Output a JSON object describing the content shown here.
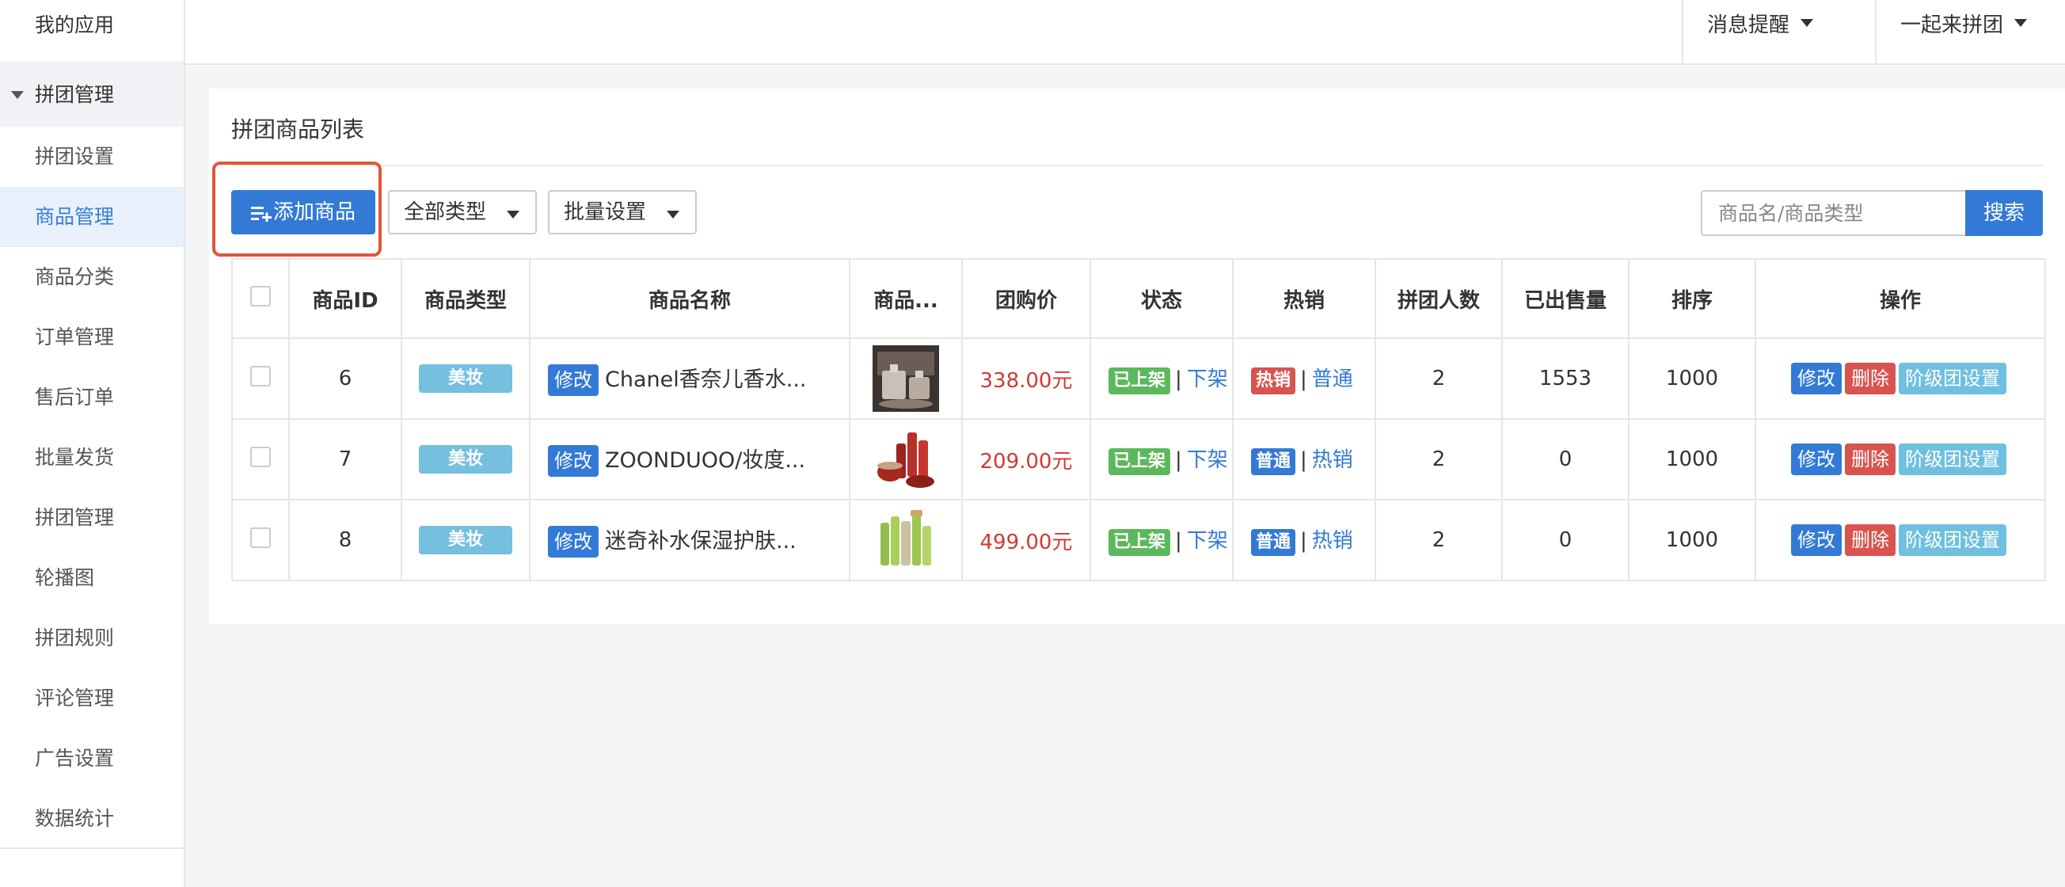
{
  "sidebar": {
    "app_title": "我的应用",
    "group_label": "拼团管理",
    "items": [
      {
        "label": "拼团设置",
        "active": false
      },
      {
        "label": "商品管理",
        "active": true
      },
      {
        "label": "商品分类",
        "active": false
      },
      {
        "label": "订单管理",
        "active": false
      },
      {
        "label": "售后订单",
        "active": false
      },
      {
        "label": "批量发货",
        "active": false
      },
      {
        "label": "拼团管理",
        "active": false
      },
      {
        "label": "轮播图",
        "active": false
      },
      {
        "label": "拼团规则",
        "active": false
      },
      {
        "label": "评论管理",
        "active": false
      },
      {
        "label": "广告设置",
        "active": false
      },
      {
        "label": "数据统计",
        "active": false
      }
    ]
  },
  "topbar": {
    "notifications_label": "消息提醒",
    "account_label": "一起来拼团"
  },
  "panel": {
    "title": "拼团商品列表",
    "add_button_label": "添加商品",
    "type_filter_label": "全部类型",
    "batch_label": "批量设置",
    "search_placeholder": "商品名/商品类型",
    "search_button_label": "搜索"
  },
  "table": {
    "headers": [
      "商品ID",
      "商品类型",
      "商品名称",
      "商品...",
      "团购价",
      "状态",
      "热销",
      "拼团人数",
      "已出售量",
      "排序",
      "操作"
    ],
    "rows": [
      {
        "id": "6",
        "type": "美妆",
        "edit_label": "修改",
        "name": "Chanel香奈儿香水...",
        "image_icon": "perfume-icon",
        "price": "338.00元",
        "status_tag": "已上架",
        "status_link": "下架",
        "hot_tag": "热销",
        "hot_tag_color": "#d9534f",
        "hot_link": "普通",
        "group_size": "2",
        "sold": "1553",
        "sort": "1000",
        "op_edit": "修改",
        "op_delete": "删除",
        "op_tier": "阶级团设置"
      },
      {
        "id": "7",
        "type": "美妆",
        "edit_label": "修改",
        "name": "ZOONDUOO/妆度...",
        "image_icon": "skincare-set-icon",
        "price": "209.00元",
        "status_tag": "已上架",
        "status_link": "下架",
        "hot_tag": "普通",
        "hot_tag_color": "#337ad6",
        "hot_link": "热销",
        "group_size": "2",
        "sold": "0",
        "sort": "1000",
        "op_edit": "修改",
        "op_delete": "删除",
        "op_tier": "阶级团设置"
      },
      {
        "id": "8",
        "type": "美妆",
        "edit_label": "修改",
        "name": "迷奇补水保湿护肤...",
        "image_icon": "green-bottles-icon",
        "price": "499.00元",
        "status_tag": "已上架",
        "status_link": "下架",
        "hot_tag": "普通",
        "hot_tag_color": "#337ad6",
        "hot_link": "热销",
        "group_size": "2",
        "sold": "0",
        "sort": "1000",
        "op_edit": "修改",
        "op_delete": "删除",
        "op_tier": "阶级团设置"
      }
    ]
  },
  "colors": {
    "primary": "#337ad6",
    "danger": "#d9534f",
    "success": "#5cb85c",
    "info": "#6fc0de",
    "price": "#d03b31",
    "highlight": "#e2553a"
  }
}
